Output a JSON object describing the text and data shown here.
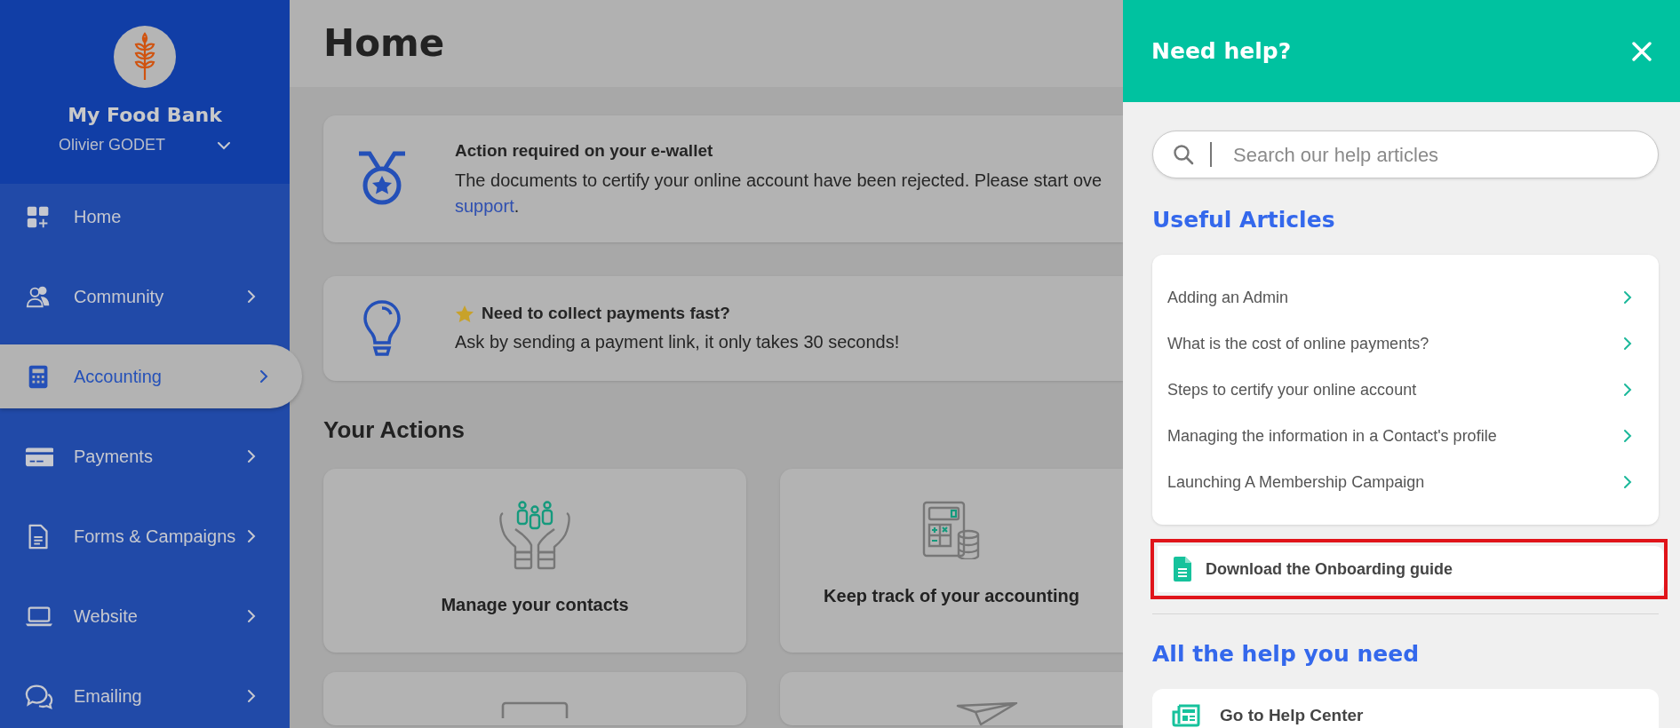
{
  "sidebar": {
    "org_name": "My Food Bank",
    "user_name": "Olivier GODET",
    "items": [
      {
        "label": "Home",
        "has_submenu": false,
        "selected": false
      },
      {
        "label": "Community",
        "has_submenu": true,
        "selected": false
      },
      {
        "label": "Accounting",
        "has_submenu": true,
        "selected": true
      },
      {
        "label": "Payments",
        "has_submenu": true,
        "selected": false
      },
      {
        "label": "Forms & Campaigns",
        "has_submenu": true,
        "selected": false
      },
      {
        "label": "Website",
        "has_submenu": true,
        "selected": false
      },
      {
        "label": "Emailing",
        "has_submenu": true,
        "selected": false
      }
    ]
  },
  "main": {
    "title": "Home",
    "notices": [
      {
        "title": "Action required on your e-wallet",
        "starred": false,
        "body": "The documents to certify your online account have been rejected. Please start ove",
        "link": "support",
        "after_link": "."
      },
      {
        "title": "Need to collect payments fast?",
        "starred": true,
        "body": "Ask by sending a payment link, it only takes 30 seconds!"
      }
    ],
    "actions_heading": "Your Actions",
    "actions": [
      {
        "label": "Manage your contacts"
      },
      {
        "label": "Keep track of your accounting"
      }
    ]
  },
  "help": {
    "title": "Need help?",
    "search": {
      "placeholder": "Search our help articles"
    },
    "useful_heading": "Useful Articles",
    "articles": [
      {
        "label": "Adding an Admin"
      },
      {
        "label": "What is the cost of online payments?"
      },
      {
        "label": "Steps to certify your online account"
      },
      {
        "label": "Managing the information in a Contact's profile"
      },
      {
        "label": "Launching A Membership Campaign"
      }
    ],
    "download": {
      "label": "Download the Onboarding guide",
      "highlighted": true
    },
    "all_help_heading": "All the help you need",
    "links": [
      {
        "label": "Go to Help Center"
      }
    ]
  }
}
